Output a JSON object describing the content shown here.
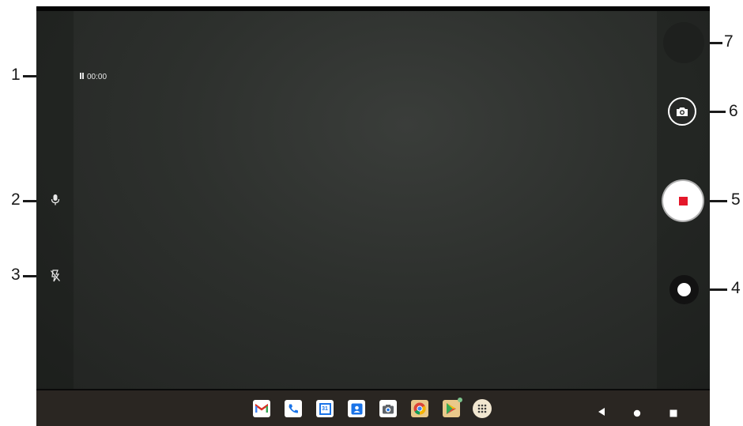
{
  "callouts": [
    "1",
    "2",
    "3",
    "4",
    "5",
    "6",
    "7"
  ],
  "recording": {
    "timer": "00:00"
  },
  "left_controls": {
    "mic_icon": "microphone-icon",
    "flash_icon": "flash-off-icon"
  },
  "right_controls": {
    "thumbnail": "gallery-thumbnail",
    "snapshot_icon": "camera-icon",
    "stop_icon": "stop-icon",
    "pause_icon": "pause-icon"
  },
  "taskbar": {
    "apps": [
      "gmail-icon",
      "phone-icon",
      "calendar-icon",
      "contacts-icon",
      "camera-app-icon",
      "chrome-icon",
      "play-store-icon",
      "app-drawer-icon"
    ],
    "calendar_day": "31",
    "nav": [
      "back-icon",
      "home-icon",
      "recents-icon"
    ]
  },
  "colors": {
    "stop": "#e4172a",
    "taskbar": "#2a2622"
  }
}
